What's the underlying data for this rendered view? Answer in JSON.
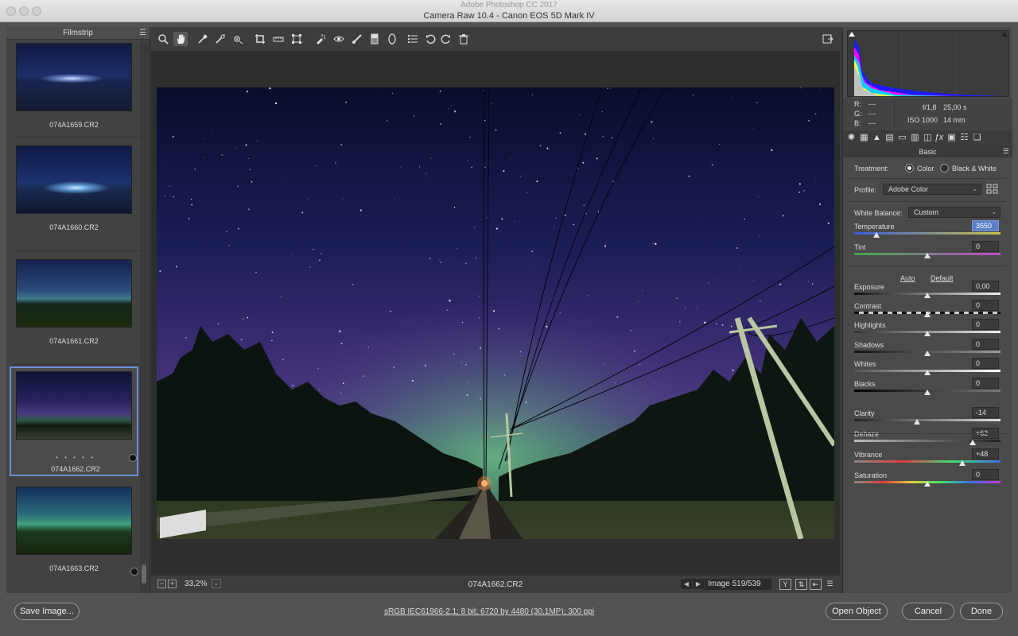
{
  "window": {
    "app_title": "Adobe Photoshop CC 2017",
    "title": "Camera Raw 10.4  -  Canon EOS 5D Mark IV"
  },
  "filmstrip": {
    "header": "Filmstrip",
    "items": [
      {
        "filename": "074A1659.CR2"
      },
      {
        "filename": "074A1660.CR2"
      },
      {
        "filename": "074A1661.CR2"
      },
      {
        "filename": "074A1662.CR2",
        "selected": true,
        "rating_dots": "• • • • •"
      },
      {
        "filename": "074A1663.CR2"
      }
    ]
  },
  "toolbar": {
    "tools": [
      "zoom-tool",
      "hand-tool",
      "white-balance-tool",
      "color-sampler-tool",
      "targeted-adjustment-tool",
      "crop-tool",
      "straighten-tool",
      "transform-tool",
      "spot-removal-tool",
      "red-eye-tool",
      "adjustment-brush",
      "graduated-filter",
      "radial-filter",
      "open-preferences",
      "rotate-left",
      "rotate-right",
      "delete"
    ]
  },
  "status": {
    "zoom": "33,2%",
    "filename": "074A1662.CR2",
    "image_count": "Image 519/539"
  },
  "info": {
    "r_label": "R:",
    "g_label": "G:",
    "b_label": "B:",
    "r_val": "---",
    "g_val": "---",
    "b_val": "---",
    "aperture": "f/1,8",
    "shutter": "25,00 s",
    "iso": "ISO 1000",
    "focal": "14 mm"
  },
  "basic": {
    "header": "Basic",
    "treatment_label": "Treatment:",
    "treatment_color": "Color",
    "treatment_bw": "Black & White",
    "profile_label": "Profile:",
    "profile_value": "Adobe Color",
    "wb_label": "White Balance:",
    "wb_value": "Custom",
    "temperature_label": "Temperature",
    "temperature_value": "3550",
    "tint_label": "Tint",
    "tint_value": "0",
    "auto_label": "Auto",
    "default_label": "Default",
    "exposure_label": "Exposure",
    "exposure_value": "0,00",
    "contrast_label": "Contrast",
    "contrast_value": "0",
    "highlights_label": "Highlights",
    "highlights_value": "0",
    "shadows_label": "Shadows",
    "shadows_value": "0",
    "whites_label": "Whites",
    "whites_value": "0",
    "blacks_label": "Blacks",
    "blacks_value": "0",
    "clarity_label": "Clarity",
    "clarity_value": "-14",
    "dehaze_label": "Dehaze",
    "dehaze_value": "+62",
    "vibrance_label": "Vibrance",
    "vibrance_value": "+48",
    "saturation_label": "Saturation",
    "saturation_value": "0"
  },
  "slider_levels": {
    "temperature": 0.15,
    "tint": 0.5,
    "exposure": 0.5,
    "contrast": 0.5,
    "highlights": 0.5,
    "shadows": 0.5,
    "whites": 0.5,
    "blacks": 0.5,
    "clarity": 0.43,
    "dehaze": 0.81,
    "vibrance": 0.74,
    "saturation": 0.5
  },
  "footer": {
    "save_label": "Save Image...",
    "workflow_link": "sRGB IEC61966-2.1; 8 bit; 6720 by 4480 (30,1MP); 300 ppi",
    "open_label": "Open Object",
    "cancel_label": "Cancel",
    "done_label": "Done"
  },
  "colors": {
    "accent": "#5c7fc9",
    "selection_border": "#6d8ed6",
    "sky_top": "#0b0f2e",
    "aurora_green": "#3f7a5a",
    "aurora_purple": "#5a3a8a"
  }
}
